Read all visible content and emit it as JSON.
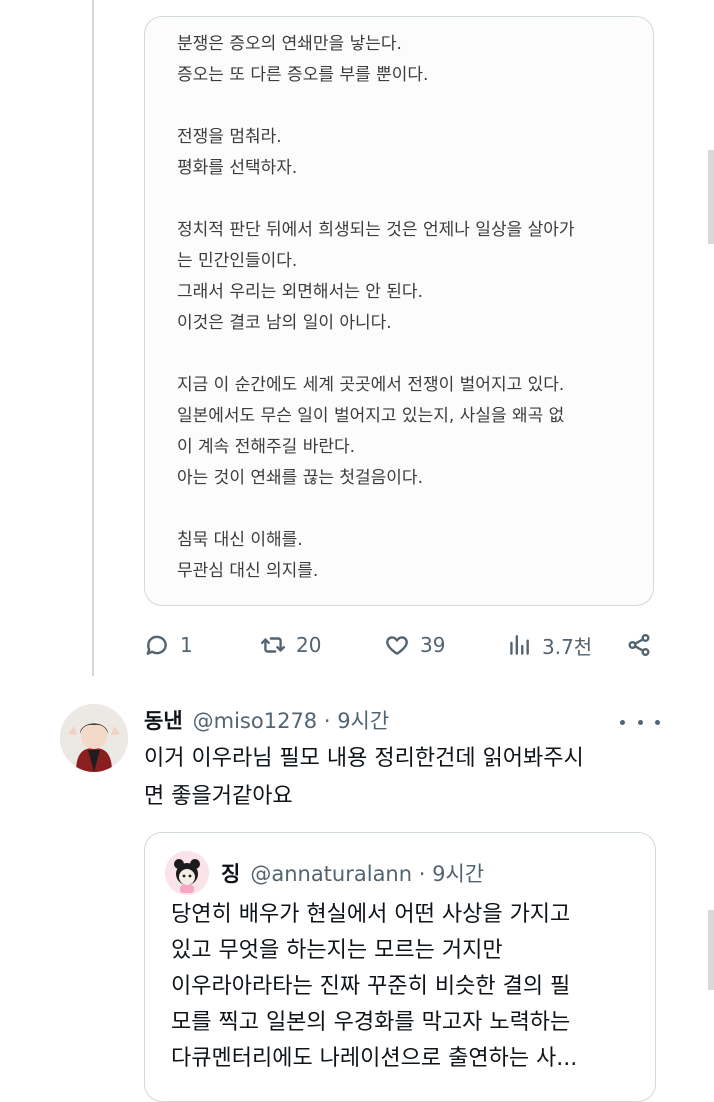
{
  "quote_card_1": {
    "lines": [
      "분쟁은 증오의 연쇄만을 낳는다.",
      "증오는 또 다른 증오를 부를 뿐이다.",
      "",
      "전쟁을 멈춰라.",
      "평화를 선택하자.",
      "",
      "정치적 판단 뒤에서 희생되는 것은 언제나 일상을 살아가",
      "는 민간인들이다.",
      "그래서 우리는 외면해서는 안 된다.",
      "이것은 결코 남의 일이 아니다.",
      "",
      "지금 이 순간에도 세계 곳곳에서 전쟁이 벌어지고 있다.",
      "일본에서도 무슨 일이 벌어지고 있는지, 사실을 왜곡 없",
      "이 계속 전해주길 바란다.",
      "아는 것이 연쇄를 끊는 첫걸음이다.",
      "",
      "침묵 대신 이해를.",
      "무관심 대신 의지를."
    ]
  },
  "actions": {
    "reply_icon": "speech-bubble-icon",
    "replies": "1",
    "retweet_icon": "retweet-icon",
    "retweets": "20",
    "like_icon": "heart-icon",
    "likes": "39",
    "views_icon": "bar-chart-icon",
    "views": "3.7천",
    "share_icon": "share-icon"
  },
  "reply": {
    "name": "동낸",
    "handle_time": "@miso1278 · 9시간",
    "more_icon": "more-dots-icon",
    "body_lines": [
      "이거 이우라님 필모 내용 정리한건데 읽어봐주시",
      "면 좋을거같아요"
    ]
  },
  "quote_card_2": {
    "name": "징",
    "handle_time": "@annaturalann · 9시간",
    "body_lines": [
      "당연히 배우가 현실에서 어떤 사상을 가지고",
      "있고 무엇을 하는지는 모르는 거지만",
      "이우라아라타는 진짜 꾸준히 비슷한 결의 필",
      "모를 찍고 일본의 우경화를 막고자 노력하는",
      "다큐멘터리에도 나레이션으로 출연하는 사..."
    ]
  },
  "colors": {
    "muted_text": "#536471",
    "border": "#cfd9de",
    "body_text": "#0f1419"
  }
}
